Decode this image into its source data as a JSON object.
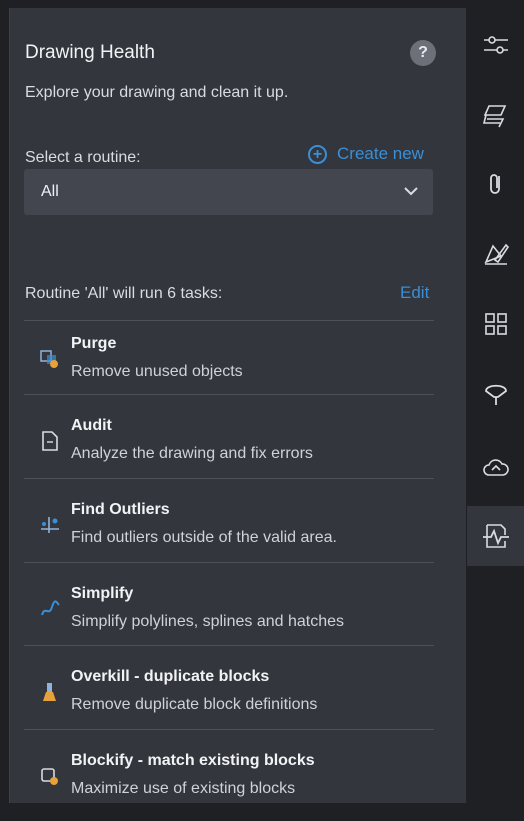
{
  "header": {
    "title": "Drawing Health",
    "help_label": "?"
  },
  "subtitle": "Explore your drawing and clean it up.",
  "routine": {
    "select_label": "Select a routine:",
    "create_new_label": "Create new",
    "selected_value": "All",
    "info_text": "Routine 'All' will run 6 tasks:",
    "edit_label": "Edit"
  },
  "tasks": [
    {
      "title": "Purge",
      "description": "Remove unused objects",
      "icon": "purge-icon"
    },
    {
      "title": "Audit",
      "description": "Analyze the drawing and fix errors",
      "icon": "audit-icon"
    },
    {
      "title": "Find Outliers",
      "description": "Find outliers outside of the valid area.",
      "icon": "find-outliers-icon"
    },
    {
      "title": "Simplify",
      "description": "Simplify polylines, splines and hatches",
      "icon": "simplify-icon"
    },
    {
      "title": "Overkill - duplicate blocks",
      "description": "Remove duplicate block definitions",
      "icon": "overkill-icon"
    },
    {
      "title": "Blockify - match existing blocks",
      "description": "Maximize use of existing blocks",
      "icon": "blockify-icon"
    }
  ],
  "sidebar": {
    "items": [
      "properties-sliders-icon",
      "layers-icon",
      "attach-icon",
      "markup-icon",
      "blocks-grid-icon",
      "balloon-icon",
      "cloud-icon",
      "drawing-health-icon"
    ],
    "active": "drawing-health-icon"
  },
  "colors": {
    "accent": "#3a8fd6",
    "panel": "#33363d",
    "background": "#1f2024"
  }
}
